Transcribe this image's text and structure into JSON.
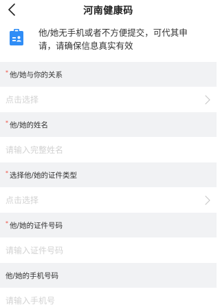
{
  "header": {
    "back_icon": "chevron-left-icon",
    "title": "河南健康码"
  },
  "notice": {
    "icon": "clipboard-user-icon",
    "text_line1": "他/她无手机或者不方便提交，可代其申",
    "text_line2": "请，请确保信息真实有效",
    "icon_color": "#2f8df6"
  },
  "form": {
    "required_mark": "*",
    "relationship": {
      "label": "他/她与你的关系",
      "value": "点击选择"
    },
    "name": {
      "label": "他/她的姓名",
      "placeholder": "请输入完整姓名"
    },
    "id_type": {
      "label": "选择他/她的证件类型",
      "value": "点击选择"
    },
    "id_number": {
      "label": "他/她的证件号码",
      "placeholder": "请输入证件号码"
    },
    "phone": {
      "label": "他/她的手机号码",
      "placeholder": "请输入手机号"
    }
  },
  "colors": {
    "required": "#f04b3c",
    "label_bg": "#f1f2f4",
    "placeholder": "#d2d2d2"
  }
}
